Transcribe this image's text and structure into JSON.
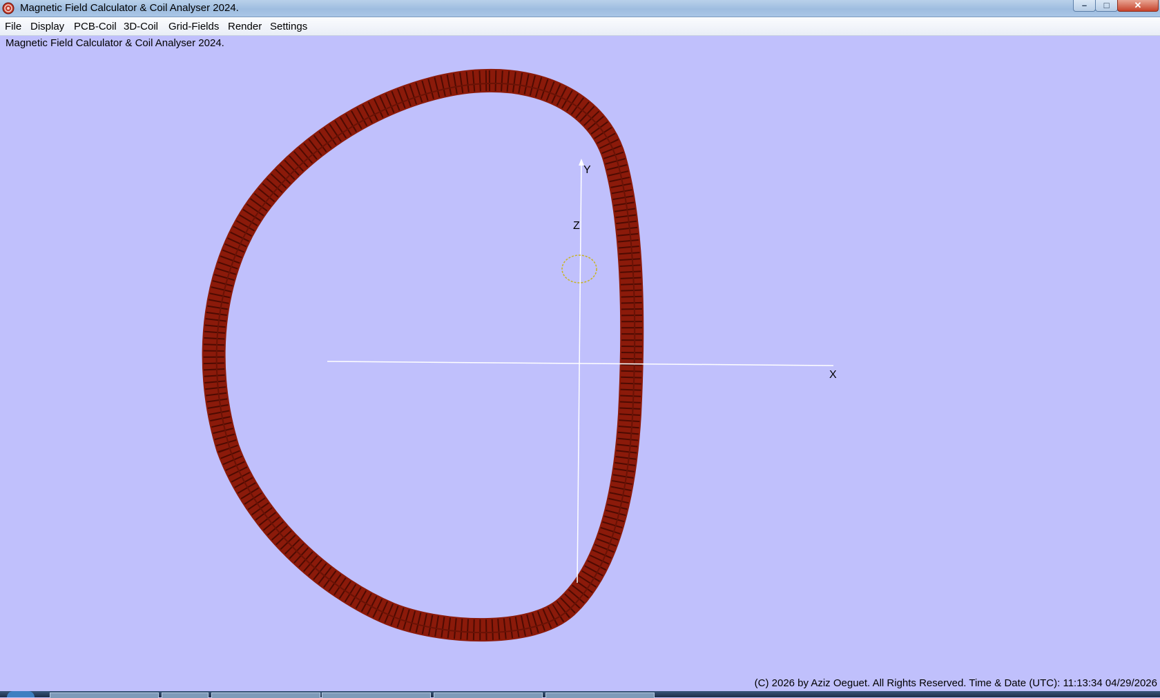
{
  "window": {
    "title": "Magnetic Field Calculator & Coil Analyser 2024.",
    "minimize_glyph": "–",
    "maximize_glyph": "□",
    "close_glyph": "✕"
  },
  "menu": {
    "items": [
      "File",
      "Display",
      "PCB-Coil",
      "3D-Coil",
      "Grid-Fields",
      "Render",
      "Settings"
    ]
  },
  "status": {
    "app_label": "Magnetic Field Calculator & Coil Analyser 2024."
  },
  "viewport": {
    "axis_labels": {
      "x": "X",
      "y": "Y",
      "z": "Z"
    },
    "colors": {
      "background": "#c0c0fc",
      "coil": "#8b1a0a",
      "coil_dark": "#5a0e04",
      "axis": "#ffffff",
      "marker": "#c8b41e"
    }
  },
  "footer": {
    "text": "(C) 2026  by Aziz Oeguet. All Rights Reserved.  Time & Date (UTC): 11:13:34  04/29/2026"
  }
}
